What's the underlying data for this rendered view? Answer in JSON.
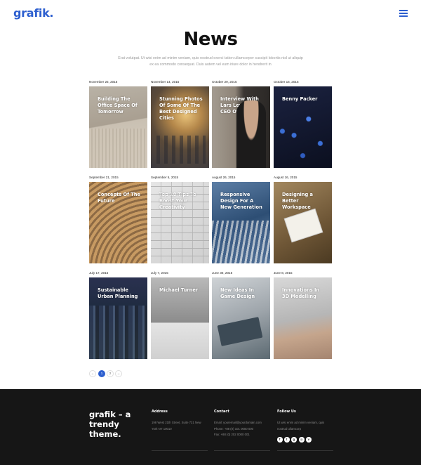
{
  "header": {
    "logo": "grafik.",
    "menu_icon": "hamburger-icon"
  },
  "page": {
    "title": "News",
    "intro": "Erat volutpat. Ut wisi enim ad minim veniam, quis nostrud exerci tation ullamcorper suscipit lobortis nisl ut aliquip ex ea commodo consequat. Duis autem vel eum iriure dolor in hendrerit in"
  },
  "posts": [
    {
      "date": "November 25, 2015",
      "title": "Building The Office Space Of Tomorrow"
    },
    {
      "date": "November 14, 2015",
      "title": "Stunning Photos Of Some Of The Best Designed Cities"
    },
    {
      "date": "October 29, 2015",
      "title": "Interview With Lars Levine, CEO Of DigiArch"
    },
    {
      "date": "October 16, 2015",
      "title": "Benny Packer"
    },
    {
      "date": "September 21, 2015",
      "title": "Concepts Of The Future"
    },
    {
      "date": "September 5, 2015",
      "title": "Top 10 Tips To Boost Your Creativity"
    },
    {
      "date": "August 26, 2015",
      "title": "Responsive Design For A New Generation"
    },
    {
      "date": "August 16, 2015",
      "title": "Designing a Better Workspace"
    },
    {
      "date": "July 17, 2015",
      "title": "Sustainable Urban Planning"
    },
    {
      "date": "July 7, 2015",
      "title": "Michael Turner"
    },
    {
      "date": "June 30, 2015",
      "title": "New Ideas In Game Design"
    },
    {
      "date": "June 8, 2015",
      "title": "Innovations In 3D Modelling"
    }
  ],
  "pagination": {
    "prev": "←",
    "pages": [
      "1",
      "2"
    ],
    "current": "1",
    "next": "→"
  },
  "footer": {
    "brand": "grafik – a trendy theme.",
    "address": {
      "heading": "Address",
      "text": "198 West 21th Street, Suite 721 New York NY 10010"
    },
    "contact": {
      "heading": "Contact",
      "email": "Email: youremail@yourdomain.com",
      "phone": "Phone: +88 (0) 101 0000 000",
      "fax": "Fax: +88 (0) 202 0000 001"
    },
    "follow": {
      "heading": "Follow Us",
      "text": "Ut wisi enim ad minim veniam, quis nostrud ullamcorp"
    },
    "social_icons": [
      "facebook-icon",
      "twitter-icon",
      "google-plus-icon",
      "instagram-icon",
      "vimeo-icon"
    ],
    "social_glyphs": [
      "f",
      "t",
      "g",
      "◎",
      "v"
    ]
  },
  "colors": {
    "accent": "#2d5fcf",
    "footer_bg": "#161616"
  }
}
